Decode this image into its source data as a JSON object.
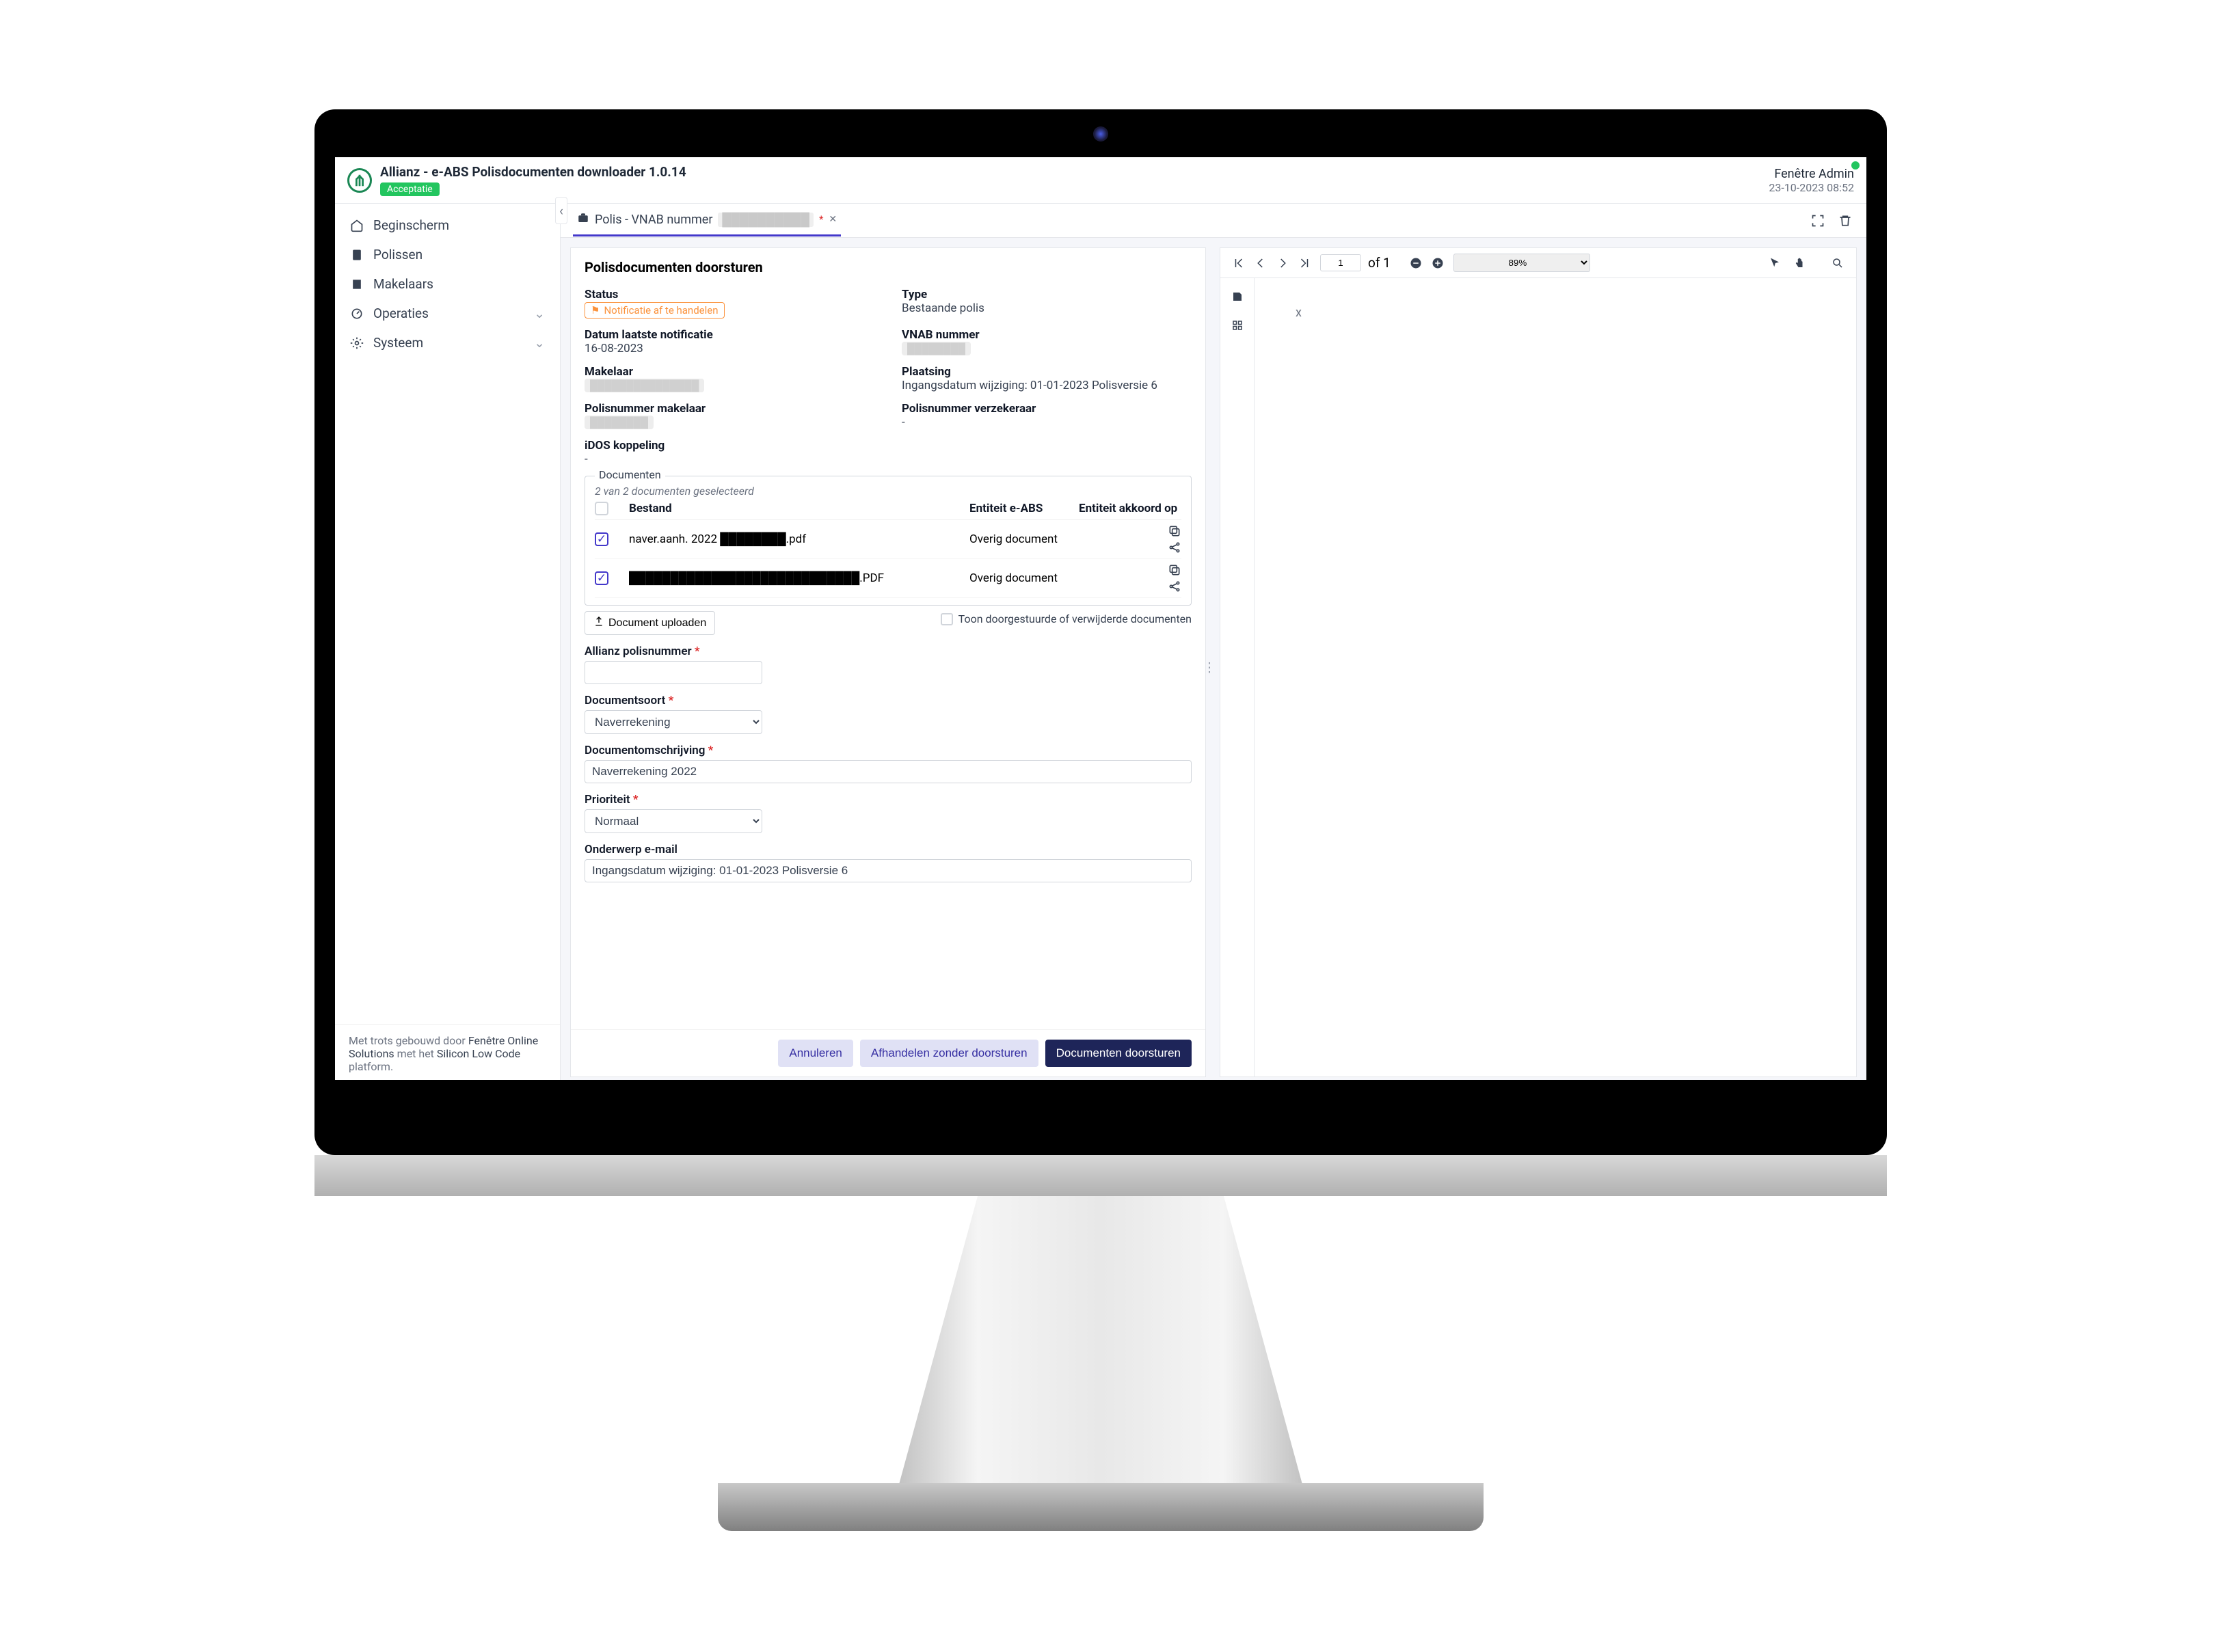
{
  "app": {
    "title": "Allianz - e-ABS Polisdocumenten downloader 1.0.14",
    "env_badge": "Acceptatie",
    "user_name": "Fenêtre Admin",
    "timestamp": "23-10-2023 08:52"
  },
  "sidebar": {
    "items": [
      {
        "label": "Beginscherm",
        "icon": "home-icon",
        "expandable": false
      },
      {
        "label": "Polissen",
        "icon": "document-icon",
        "expandable": false
      },
      {
        "label": "Makelaars",
        "icon": "building-icon",
        "expandable": false
      },
      {
        "label": "Operaties",
        "icon": "gauge-icon",
        "expandable": true
      },
      {
        "label": "Systeem",
        "icon": "gear-icon",
        "expandable": true
      }
    ],
    "footer": {
      "line1_prefix": "Met trots gebouwd door ",
      "line1_link": "Fenêtre Online Solutions",
      "line1_mid": " met het ",
      "line1_link2": "Silicon Low Code",
      "line1_suffix": " platform."
    }
  },
  "tab": {
    "icon_label": "Polis - VNAB nummer",
    "redacted": "██████████",
    "modified_marker": "*"
  },
  "panel": {
    "title": "Polisdocumenten doorsturen",
    "meta": {
      "status_label": "Status",
      "status_value": "Notificatie af te handelen",
      "type_label": "Type",
      "type_value": "Bestaande polis",
      "date_notif_label": "Datum laatste notificatie",
      "date_notif_value": "16-08-2023",
      "vnab_label": "VNAB nummer",
      "makelaar_label": "Makelaar",
      "plaatsing_label": "Plaatsing",
      "plaatsing_value": "Ingangsdatum wijziging: 01-01-2023 Polisversie 6",
      "polismak_label": "Polisnummer makelaar",
      "polisverz_label": "Polisnummer verzekeraar",
      "polisverz_value": "-",
      "idos_label": "iDOS koppeling",
      "idos_value": "-"
    },
    "documents": {
      "legend": "Documenten",
      "selected_text": "2 van 2 documenten geselecteerd",
      "col_bestand": "Bestand",
      "col_entiteit": "Entiteit e-ABS",
      "col_akkoord": "Entiteit akkoord op",
      "rows": [
        {
          "file": "naver.aanh. 2022 ████████.pdf",
          "entity": "Overig document"
        },
        {
          "file": "████████████████████████████.PDF",
          "entity": "Overig document"
        }
      ],
      "upload_btn": "Document uploaden",
      "show_removed": "Toon doorgestuurde of verwijderde documenten"
    },
    "form": {
      "polisnr_label": "Allianz polisnummer",
      "docsoort_label": "Documentsoort",
      "docsoort_value": "Naverrekening",
      "docomschr_label": "Documentomschrijving",
      "docomschr_value": "Naverrekening 2022",
      "prio_label": "Prioriteit",
      "prio_value": "Normaal",
      "onderwerp_label": "Onderwerp e-mail",
      "onderwerp_value": "Ingangsdatum wijziging: 01-01-2023 Polisversie 6"
    },
    "actions": {
      "cancel": "Annuleren",
      "handle_without": "Afhandelen zonder doorsturen",
      "forward": "Documenten doorsturen"
    }
  },
  "pdf": {
    "page_current": "1",
    "page_of": "of 1",
    "zoom": "89%",
    "content_placeholder": "x"
  }
}
